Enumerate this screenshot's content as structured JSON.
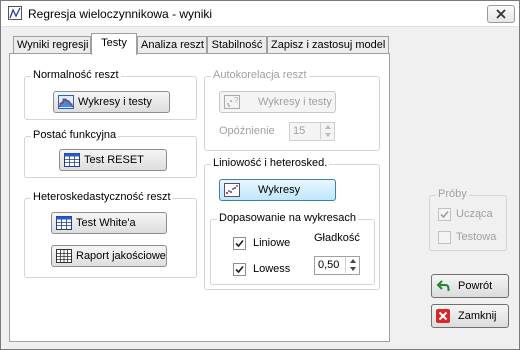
{
  "window": {
    "title": "Regresja wieloczynnikowa - wyniki"
  },
  "tabs": [
    {
      "label": "Wyniki regresji"
    },
    {
      "label": "Testy"
    },
    {
      "label": "Analiza reszt"
    },
    {
      "label": "Stabilność"
    },
    {
      "label": "Zapisz i zastosuj model"
    }
  ],
  "normality": {
    "title": "Normalność reszt",
    "charts_tests_label": "Wykresy i testy"
  },
  "functional_form": {
    "title": "Postać funkcyjna",
    "reset_label": "Test RESET"
  },
  "heteroskedasticity": {
    "title": "Heteroskedastyczność reszt",
    "white_label": "Test White'a",
    "quality_report_label": "Raport jakościowe"
  },
  "autocorrelation": {
    "title": "Autokorelacja reszt",
    "charts_tests_label": "Wykresy i testy",
    "lag_label": "Opóźnienie",
    "lag_value": "15"
  },
  "linearity": {
    "title": "Liniowość i heterosked.",
    "charts_label": "Wykresy"
  },
  "fit_on_charts": {
    "title": "Dopasowanie na wykresach",
    "smoothness_header": "Gładkość",
    "linear_label": "Liniowe",
    "linear_checked": true,
    "lowess_label": "Lowess",
    "lowess_checked": true,
    "smoothness_value": "0,50"
  },
  "samples": {
    "title": "Próby",
    "training_label": "Ucząca",
    "training_checked": true,
    "test_label": "Testowa",
    "test_checked": false
  },
  "actions": {
    "back_label": "Powrót",
    "close_label": "Zamknij"
  }
}
